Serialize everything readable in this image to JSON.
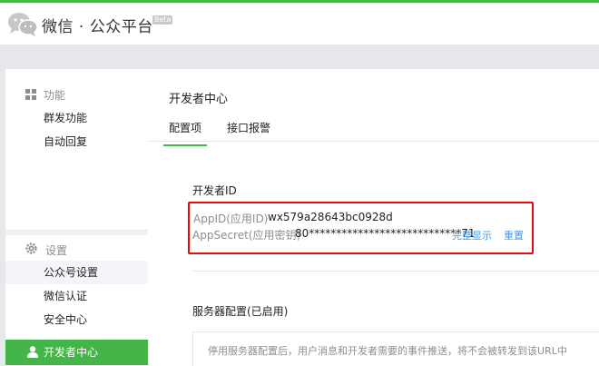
{
  "brand": {
    "title": "微信 · 公众平台",
    "beta": "Beta"
  },
  "sidebar": {
    "functions": {
      "title": "功能",
      "items": [
        {
          "label": "群发功能"
        },
        {
          "label": "自动回复"
        }
      ]
    },
    "settings": {
      "title": "设置",
      "items": [
        {
          "label": "公众号设置"
        },
        {
          "label": "微信认证"
        },
        {
          "label": "安全中心"
        }
      ]
    },
    "developer": {
      "label": "开发者中心"
    }
  },
  "main": {
    "title": "开发者中心",
    "tabs": [
      {
        "label": "配置项"
      },
      {
        "label": "接口报警"
      }
    ],
    "developer_id": {
      "heading": "开发者ID",
      "appid_label": "AppID(应用ID)",
      "appid_value": "wx579a28643bc0928d",
      "secret_label": "AppSecret(应用密钥)",
      "secret_value": "80****************************71",
      "show_link": "完整显示",
      "reset_link": "重置"
    },
    "server": {
      "heading": "服务器配置(已启用)",
      "notice": "停用服务器配置后，用户消息和开发者需要的事件推送，将不会被转发到该URL中"
    }
  },
  "colors": {
    "accent": "#44b549",
    "link": "#459ae9",
    "highlight": "#e5080d"
  },
  "icons": {
    "logo": "wechat-logo-icon",
    "functions": "grid-icon",
    "settings": "gear-icon",
    "developer": "user-icon"
  }
}
